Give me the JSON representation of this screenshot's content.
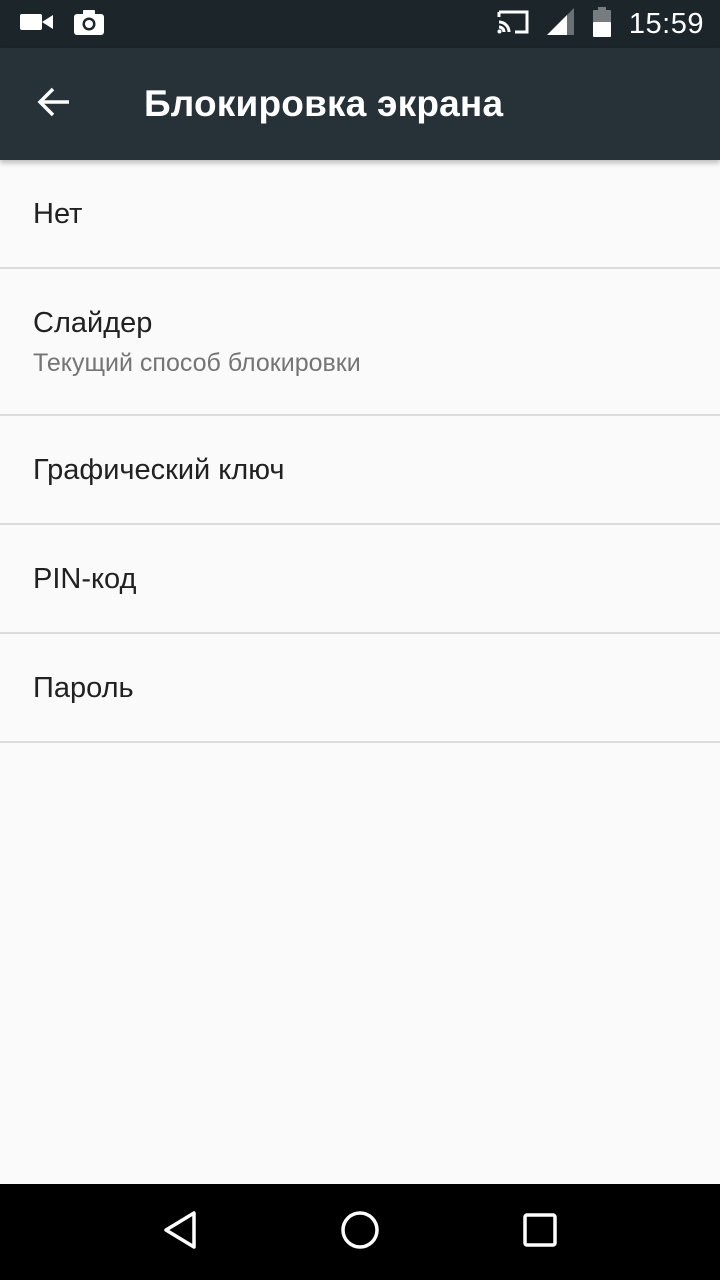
{
  "status_bar": {
    "time": "15:59",
    "left_icons": [
      "video-camera-icon",
      "camera-icon"
    ],
    "right_icons": [
      "cast-icon",
      "signal-icon",
      "battery-icon"
    ]
  },
  "app_bar": {
    "title": "Блокировка экрана",
    "back_icon": "arrow-back-icon"
  },
  "list": {
    "items": [
      {
        "title": "Нет"
      },
      {
        "title": "Слайдер",
        "subtitle": "Текущий способ блокировки"
      },
      {
        "title": "Графический ключ"
      },
      {
        "title": "PIN-код"
      },
      {
        "title": "Пароль"
      }
    ]
  },
  "nav_bar": {
    "buttons": [
      "back-triangle-icon",
      "home-circle-icon",
      "recents-square-icon"
    ]
  },
  "colors": {
    "status_bar": "#1b252a",
    "app_bar": "#263238",
    "background": "#fafafa",
    "divider": "#dcdcdc",
    "primary_text": "#212121",
    "secondary_text": "#757575"
  }
}
